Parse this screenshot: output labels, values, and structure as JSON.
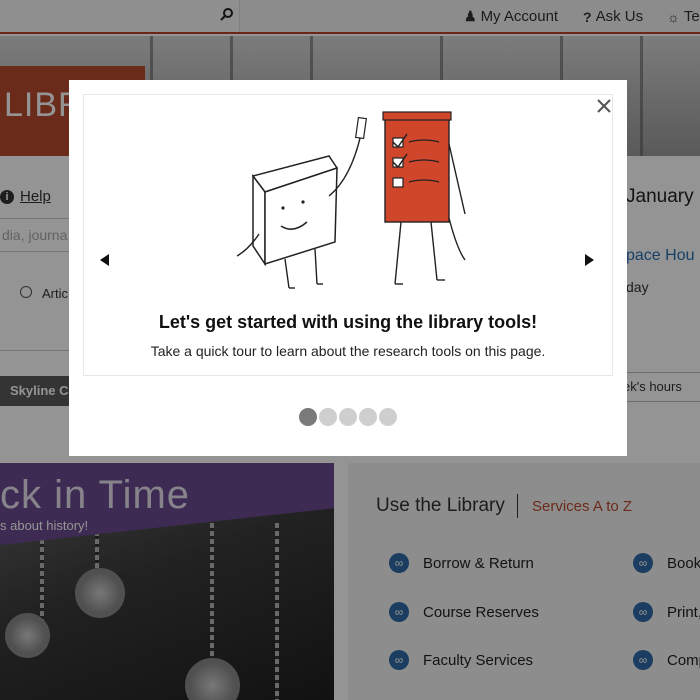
{
  "topbar": {
    "search_placeholder": "",
    "links": [
      {
        "icon": "person-icon",
        "label": "My Account"
      },
      {
        "icon": "question-icon",
        "label": "Ask Us"
      },
      {
        "icon": "lightbulb-icon",
        "label": "Tel"
      }
    ]
  },
  "hero": {
    "banner_text": "LIBRA"
  },
  "search_panel": {
    "help_label": "Help",
    "search_placeholder": "dia, journa",
    "radio_label": "Artic",
    "location_button": "Skyline Ca"
  },
  "hours_panel": {
    "date": "January 1",
    "space_hours_link": "pace Hou",
    "today_text": "day",
    "weeks_hours_button": "ek's hours"
  },
  "promo": {
    "title": "ck in Time",
    "subtitle": "s about history!"
  },
  "use_library": {
    "title": "Use the Library",
    "services_az": "Services A to Z",
    "items": [
      "Borrow & Return",
      "Course Reserves",
      "Faculty Services",
      "Book",
      "Print,",
      "Comp"
    ]
  },
  "tour_modal": {
    "heading": "Let's get started with using the library tools!",
    "description": "Take a quick tour to learn about the research tools on this page.",
    "slide_count": 5,
    "active_slide": 1,
    "illustration": "tablet-and-easel-characters-illustration"
  },
  "colors": {
    "accent_red": "#b94a2d",
    "link_blue": "#2a6fb0",
    "promo_purple": "#6a4a91",
    "dot_active": "#7a7a7a",
    "dot_inactive": "#cfcfcf"
  }
}
